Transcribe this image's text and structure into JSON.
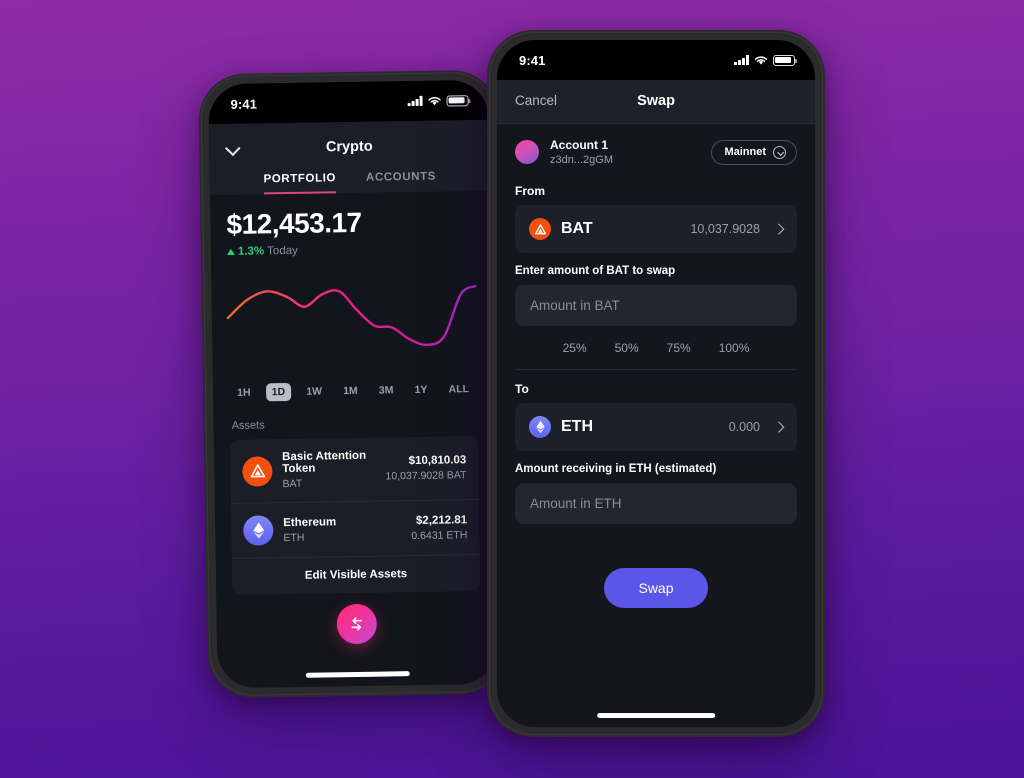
{
  "background": {
    "top_color": "#8E2BA6",
    "bottom_color": "#4B1399"
  },
  "phone_portfolio": {
    "status_bar": {
      "time": "9:41",
      "signal_icon": "signal-bars-icon",
      "wifi_icon": "wifi-icon",
      "battery_icon": "battery-icon"
    },
    "header": {
      "collapse_icon": "chevron-down-icon",
      "title": "Crypto",
      "tabs": [
        {
          "label": "PORTFOLIO",
          "active": true
        },
        {
          "label": "ACCOUNTS",
          "active": false
        }
      ]
    },
    "balance": "$12,453.17",
    "change": {
      "arrow_icon": "triangle-up-icon",
      "percent": "1.3%",
      "period": "Today"
    },
    "ranges": [
      {
        "label": "1H",
        "active": false
      },
      {
        "label": "1D",
        "active": true
      },
      {
        "label": "1W",
        "active": false
      },
      {
        "label": "1M",
        "active": false
      },
      {
        "label": "3M",
        "active": false
      },
      {
        "label": "1Y",
        "active": false
      },
      {
        "label": "ALL",
        "active": false
      }
    ],
    "assets_label": "Assets",
    "assets": [
      {
        "icon": "bat-token-icon",
        "name": "Basic Attention Token",
        "symbol": "BAT",
        "fiat": "$10,810.03",
        "amount": "10,037.9028 BAT"
      },
      {
        "icon": "eth-token-icon",
        "name": "Ethereum",
        "symbol": "ETH",
        "fiat": "$2,212.81",
        "amount": "0.6431 ETH"
      }
    ],
    "edit_assets_label": "Edit Visible Assets",
    "fab_icon": "swap-arrows-icon"
  },
  "phone_swap": {
    "status_bar": {
      "time": "9:41",
      "signal_icon": "signal-bars-icon",
      "wifi_icon": "wifi-icon",
      "battery_icon": "battery-icon"
    },
    "header": {
      "cancel_label": "Cancel",
      "title": "Swap"
    },
    "account": {
      "avatar_icon": "account-avatar",
      "name": "Account 1",
      "address": "z3dn...2gGM",
      "network_label": "Mainnet",
      "network_chevron_icon": "chevron-down-circle-icon"
    },
    "from": {
      "section_label": "From",
      "token_icon": "bat-token-icon",
      "token_symbol": "BAT",
      "balance": "10,037.9028",
      "chevron_icon": "chevron-right-icon",
      "hint": "Enter amount of BAT to swap",
      "input_placeholder": "Amount in BAT",
      "percent_options": [
        "25%",
        "50%",
        "75%",
        "100%"
      ]
    },
    "to": {
      "section_label": "To",
      "token_icon": "eth-token-icon",
      "token_symbol": "ETH",
      "balance": "0.000",
      "chevron_icon": "chevron-right-icon",
      "hint": "Amount receiving in ETH (estimated)",
      "input_placeholder": "Amount in ETH"
    },
    "swap_button_label": "Swap",
    "swap_button_color": "#5B55E8"
  },
  "chart_data": {
    "type": "line",
    "title": "Portfolio value 1D",
    "xlabel": "",
    "ylabel": "",
    "grid": false,
    "legend": null,
    "x": [
      0,
      8,
      16,
      24,
      31,
      38,
      45,
      52,
      59,
      66,
      73,
      80,
      87,
      94,
      100
    ],
    "y": [
      52,
      70,
      78,
      72,
      62,
      74,
      77,
      58,
      42,
      40,
      28,
      22,
      30,
      72,
      80
    ],
    "stroke_gradient": [
      "#F06A2A",
      "#E8347E",
      "#D61B8C",
      "#A32BD6"
    ],
    "ylim": [
      0,
      100
    ],
    "points": [
      {
        "x": 0,
        "y": 52
      },
      {
        "x": 8,
        "y": 70
      },
      {
        "x": 16,
        "y": 78
      },
      {
        "x": 24,
        "y": 72
      },
      {
        "x": 31,
        "y": 62
      },
      {
        "x": 38,
        "y": 74
      },
      {
        "x": 45,
        "y": 77
      },
      {
        "x": 52,
        "y": 58
      },
      {
        "x": 59,
        "y": 42
      },
      {
        "x": 66,
        "y": 40
      },
      {
        "x": 73,
        "y": 28
      },
      {
        "x": 80,
        "y": 22
      },
      {
        "x": 87,
        "y": 30
      },
      {
        "x": 94,
        "y": 72
      },
      {
        "x": 100,
        "y": 80
      }
    ]
  }
}
